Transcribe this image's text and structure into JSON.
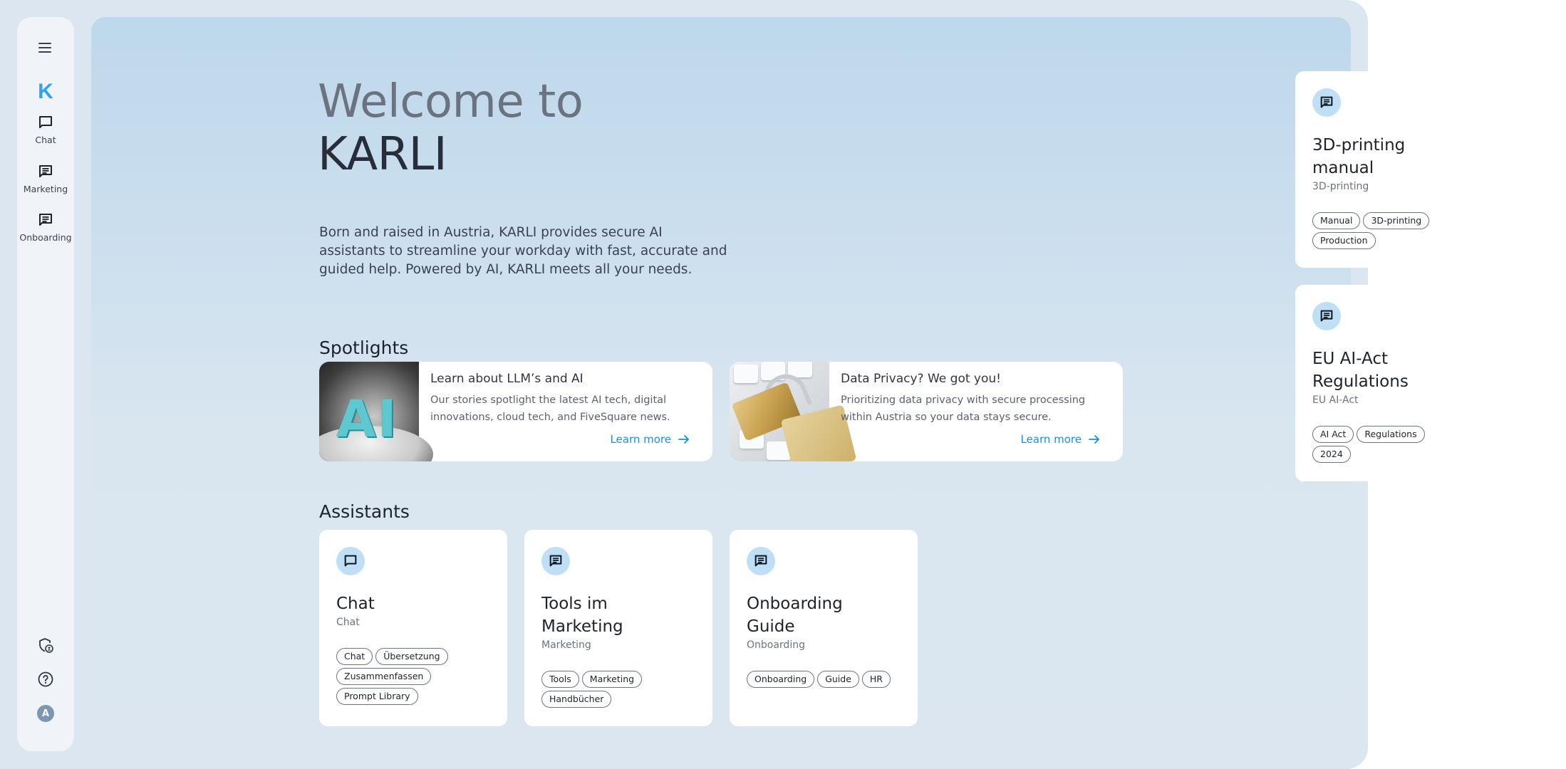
{
  "sidebar": {
    "menu_icon": "hamburger-menu-icon",
    "logo": "K",
    "items": [
      {
        "label": "Chat",
        "icon": "chat-bubble-outline-icon"
      },
      {
        "label": "Marketing",
        "icon": "chat-text-icon"
      },
      {
        "label": "Onboarding",
        "icon": "chat-text-icon"
      }
    ],
    "bottom": {
      "privacy_icon": "shield-user-icon",
      "help_icon": "help-circle-icon",
      "avatar_initial": "A"
    }
  },
  "hero": {
    "title_line1": "Welcome to",
    "title_line2": "KARLI",
    "intro": "Born and raised in Austria, KARLI provides secure AI assistants to streamline your workday with fast, accurate and guided help. Powered by AI, KARLI meets all your needs."
  },
  "spotlights": {
    "heading": "Spotlights",
    "items": [
      {
        "title": "Learn about LLM’s and AI",
        "description": "Our stories spotlight the latest AI tech, digital innovations, cloud tech, and FiveSquare news.",
        "link": "Learn more",
        "image_alt": "AI"
      },
      {
        "title": "Data Privacy? We got you!",
        "description": "Prioritizing data privacy with secure processing within Austria so your data stays secure.",
        "link": "Learn more",
        "image_alt": "padlock on keyboard"
      }
    ]
  },
  "assistants": {
    "heading": "Assistants",
    "items": [
      {
        "name": "Chat",
        "category": "Chat",
        "icon": "chat-bubble-outline-icon",
        "tags": [
          "Chat",
          "Übersetzung",
          "Zusammenfassen",
          "Prompt Library"
        ]
      },
      {
        "name": "Tools im Marketing",
        "category": "Marketing",
        "icon": "chat-text-icon",
        "tags": [
          "Tools",
          "Marketing",
          "Handbücher"
        ]
      },
      {
        "name": "Onboarding Guide",
        "category": "Onboarding",
        "icon": "chat-text-icon",
        "tags": [
          "Onboarding",
          "Guide",
          "HR"
        ]
      }
    ]
  },
  "side_cards": [
    {
      "name": "3D-printing manual",
      "category": "3D-printing",
      "icon": "chat-text-icon",
      "tags": [
        "Manual",
        "3D-printing",
        "Production"
      ]
    },
    {
      "name": "EU AI-Act Regulations",
      "category": "EU AI-Act",
      "icon": "chat-text-icon",
      "tags": [
        "AI Act",
        "Regulations",
        "2024"
      ]
    }
  ],
  "colors": {
    "accent": "#1a8ee6",
    "logo": "#2fa3ee",
    "icon_bg": "#bfdff7",
    "frame": "#dbe6f0",
    "sidebar": "#f0f4f8"
  }
}
